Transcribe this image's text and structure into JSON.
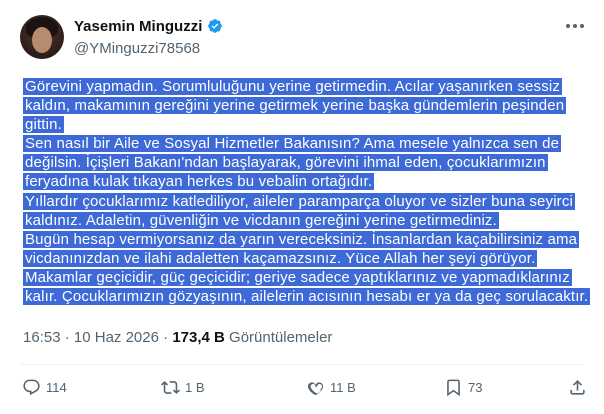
{
  "author": {
    "display_name": "Yasemin Minguzzi",
    "handle": "@YMinguzzi78568"
  },
  "tweet_lines": [
    "Görevini yapmadın. Sorumluluğunu yerine getirmedin. Acılar yaşanırken sessiz",
    "kaldın, makamının gereğini yerine getirmek yerine başka gündemlerin peşinden",
    "gittin.",
    "Sen nasıl bir Aile ve Sosyal Hizmetler Bakanısın? Ama mesele yalnızca sen de",
    "değilsin. İçişleri Bakanı'ndan başlayarak, görevini ihmal eden, çocuklarımızın",
    "feryadına kulak tıkayan herkes bu vebalin ortağıdır.",
    "Yıllardır çocuklarımız katlediliyor, aileler paramparça oluyor ve sizler buna seyirci",
    "kaldınız. Adaletin, güvenliğin ve vicdanın gereğini yerine getirmediniz.",
    "Bugün hesap vermiyorsanız da yarın vereceksiniz. İnsanlardan kaçabilirsiniz ama",
    "vicdanınızdan ve ilahi adaletten kaçamazsınız. Yüce Allah her şeyi görüyor.",
    "Makamlar geçicidir, güç geçicidir; geriye sadece yaptıklarınız ve yapmadıklarınız",
    "kalır. Çocuklarımızın gözyaşının, ailelerin acısının hesabı er ya da geç sorulacaktır."
  ],
  "meta": {
    "time": "16:53",
    "separator": "·",
    "date": "10 Haz 2026",
    "views_count": "173,4 B",
    "views_label": "Görüntülemeler"
  },
  "actions": {
    "replies": "114",
    "reposts": "1 B",
    "likes": "11 B",
    "bookmarks": "73"
  },
  "colors": {
    "selection": "#3d6ad6",
    "verified": "#1d9bf0",
    "secondary_text": "#536471"
  },
  "icons": [
    "verified-badge-icon",
    "more-icon",
    "reply-icon",
    "repost-icon",
    "like-icon",
    "bookmark-icon",
    "share-icon"
  ]
}
